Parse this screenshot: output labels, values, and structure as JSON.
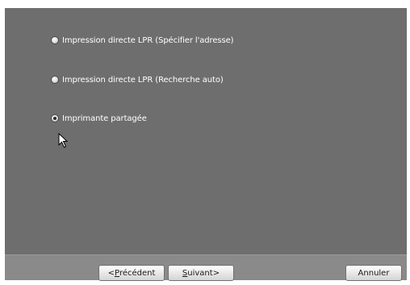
{
  "options": [
    {
      "label": "Impression directe LPR (Spécifier l'adresse)",
      "checked": false
    },
    {
      "label": "Impression directe LPR (Recherche auto)",
      "checked": false
    },
    {
      "label": "Imprimante partagée",
      "checked": true
    }
  ],
  "buttons": {
    "back": {
      "prefix": "< ",
      "accel": "P",
      "rest": "récédent"
    },
    "next": {
      "accel": "S",
      "rest": "uivant",
      "suffix": " >"
    },
    "cancel": "Annuler"
  },
  "cursor": "arrow-pointer-icon"
}
